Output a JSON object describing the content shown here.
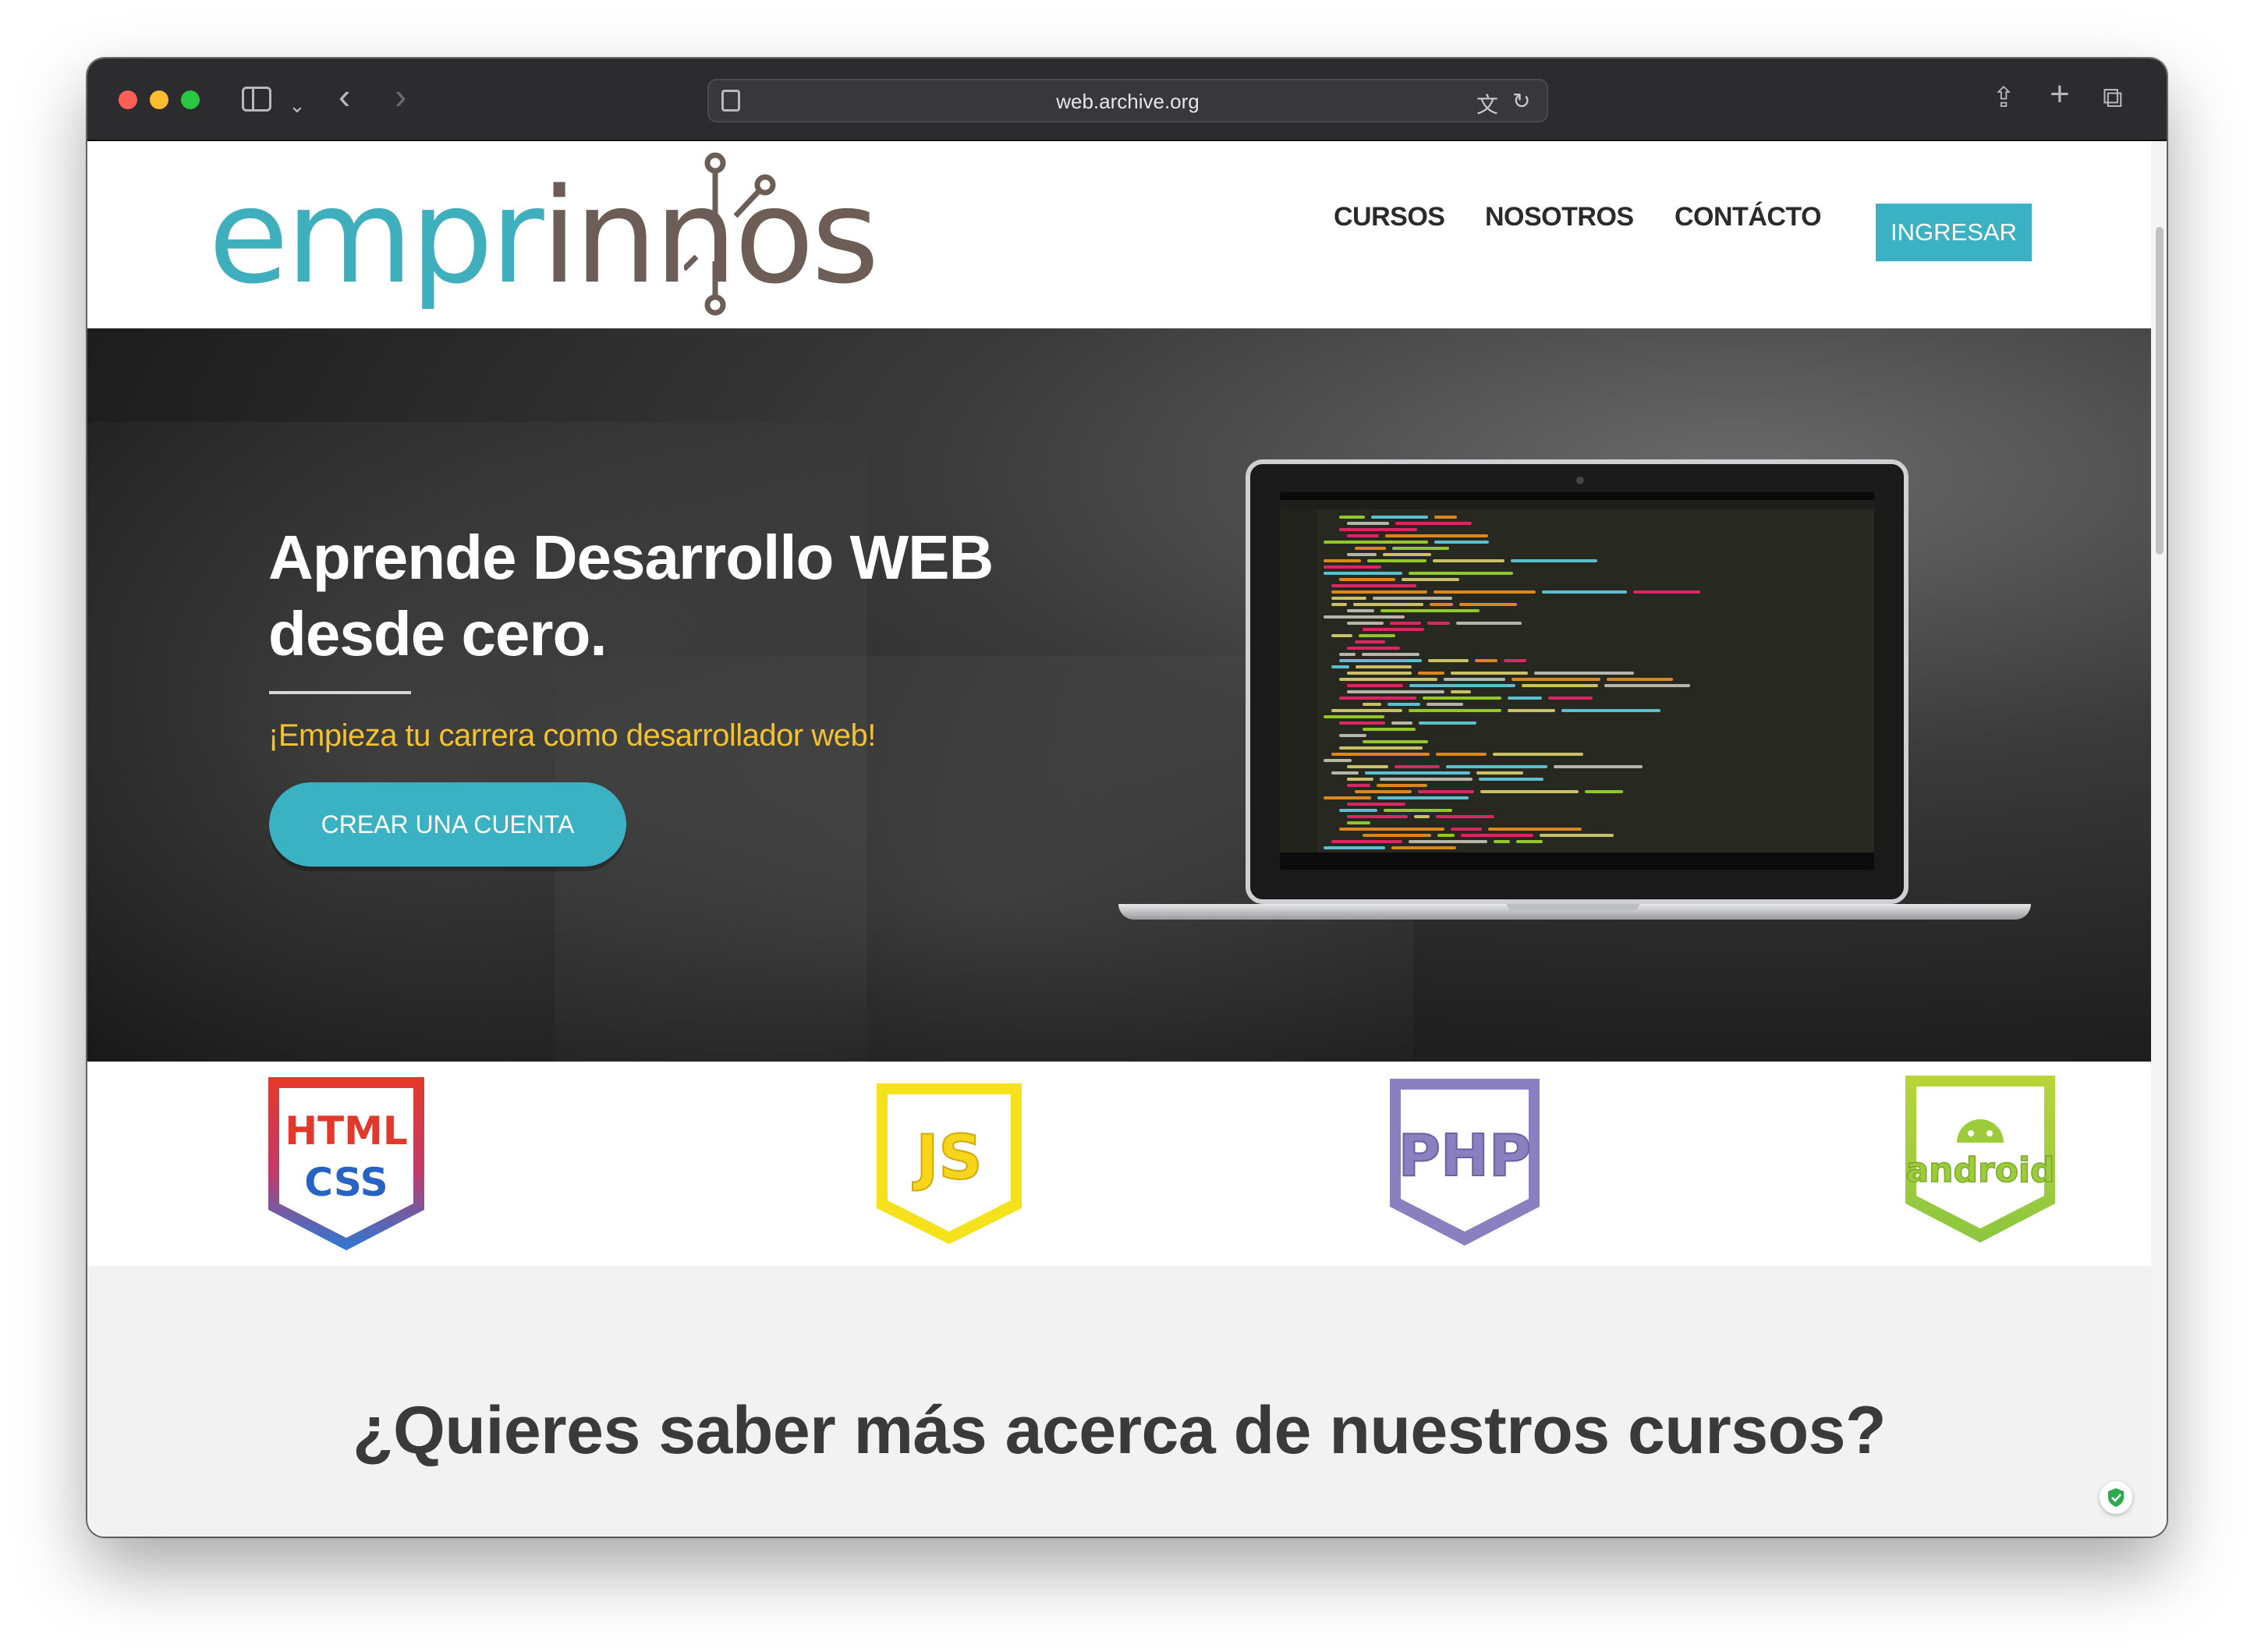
{
  "browser": {
    "url": "web.archive.org"
  },
  "site": {
    "logo": {
      "part1": "empr",
      "part2": "innos"
    },
    "nav": [
      "CURSOS",
      "NOSOTROS",
      "CONTÁCTO"
    ],
    "login_label": "INGRESAR"
  },
  "hero": {
    "title_line1": "Aprende Desarrollo WEB",
    "title_line2": "desde cero.",
    "subtitle": "¡Empieza tu carrera como desarrollador web!",
    "cta_label": "CREAR UNA CUENTA"
  },
  "badges": {
    "html_css": {
      "line1": "HTML",
      "line2": "CSS"
    },
    "js": "JS",
    "php": "PHP",
    "android": "android"
  },
  "section": {
    "title": "¿Quieres saber más acerca de nuestros cursos?"
  },
  "colors": {
    "brand_teal": "#3bb1c4",
    "brand_brown": "#6d5d57",
    "hero_subtitle": "#f2c230"
  }
}
